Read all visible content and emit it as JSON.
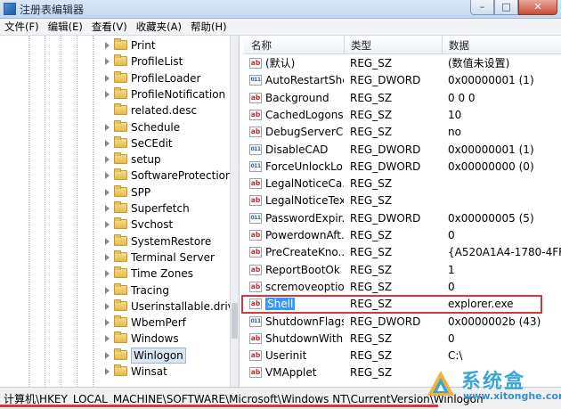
{
  "window": {
    "title": "注册表编辑器",
    "buttons": [
      "–",
      "□",
      "✕"
    ]
  },
  "menu": [
    {
      "label": "文件(F)"
    },
    {
      "label": "编辑(E)"
    },
    {
      "label": "查看(V)"
    },
    {
      "label": "收藏夹(A)"
    },
    {
      "label": "帮助(H)"
    }
  ],
  "tree": {
    "items": [
      {
        "label": "Print",
        "expandable": true
      },
      {
        "label": "ProfileList",
        "expandable": true
      },
      {
        "label": "ProfileLoader",
        "expandable": true
      },
      {
        "label": "ProfileNotification",
        "expandable": true
      },
      {
        "label": "related.desc",
        "expandable": false
      },
      {
        "label": "Schedule",
        "expandable": true
      },
      {
        "label": "SeCEdit",
        "expandable": true
      },
      {
        "label": "setup",
        "expandable": true
      },
      {
        "label": "SoftwareProtectionP",
        "expandable": true
      },
      {
        "label": "SPP",
        "expandable": true
      },
      {
        "label": "Superfetch",
        "expandable": true
      },
      {
        "label": "Svchost",
        "expandable": true
      },
      {
        "label": "SystemRestore",
        "expandable": true
      },
      {
        "label": "Terminal Server",
        "expandable": true
      },
      {
        "label": "Time Zones",
        "expandable": true
      },
      {
        "label": "Tracing",
        "expandable": true
      },
      {
        "label": "Userinstallable.drive",
        "expandable": true
      },
      {
        "label": "WbemPerf",
        "expandable": true
      },
      {
        "label": "Windows",
        "expandable": true
      },
      {
        "label": "Winlogon",
        "expandable": true,
        "selected": true
      },
      {
        "label": "Winsat",
        "expandable": true
      }
    ]
  },
  "list": {
    "headers": {
      "name": "名称",
      "type": "类型",
      "data": "数据"
    },
    "rows": [
      {
        "name": "(默认)",
        "type": "REG_SZ",
        "data": "(数值未设置)",
        "kind": "sz"
      },
      {
        "name": "AutoRestartShell",
        "type": "REG_DWORD",
        "data": "0x00000001 (1)",
        "kind": "dword"
      },
      {
        "name": "Background",
        "type": "REG_SZ",
        "data": "0 0 0",
        "kind": "sz"
      },
      {
        "name": "CachedLogons...",
        "type": "REG_SZ",
        "data": "10",
        "kind": "sz"
      },
      {
        "name": "DebugServerC...",
        "type": "REG_SZ",
        "data": "no",
        "kind": "sz"
      },
      {
        "name": "DisableCAD",
        "type": "REG_DWORD",
        "data": "0x00000001 (1)",
        "kind": "dword"
      },
      {
        "name": "ForceUnlockLo...",
        "type": "REG_DWORD",
        "data": "0x00000000 (0)",
        "kind": "dword"
      },
      {
        "name": "LegalNoticeCa...",
        "type": "REG_SZ",
        "data": "",
        "kind": "sz"
      },
      {
        "name": "LegalNoticeText",
        "type": "REG_SZ",
        "data": "",
        "kind": "sz"
      },
      {
        "name": "PasswordExpir...",
        "type": "REG_DWORD",
        "data": "0x00000005 (5)",
        "kind": "dword"
      },
      {
        "name": "PowerdownAft...",
        "type": "REG_SZ",
        "data": "0",
        "kind": "sz"
      },
      {
        "name": "PreCreateKno...",
        "type": "REG_SZ",
        "data": "{A520A1A4-1780-4FF",
        "kind": "sz"
      },
      {
        "name": "ReportBootOk",
        "type": "REG_SZ",
        "data": "1",
        "kind": "sz"
      },
      {
        "name": "scremoveoption",
        "type": "REG_SZ",
        "data": "0",
        "kind": "sz"
      },
      {
        "name": "Shell",
        "type": "REG_SZ",
        "data": "explorer.exe",
        "kind": "sz",
        "selected": true
      },
      {
        "name": "ShutdownFlags",
        "type": "REG_DWORD",
        "data": "0x0000002b (43)",
        "kind": "dword"
      },
      {
        "name": "ShutdownWith...",
        "type": "REG_SZ",
        "data": "0",
        "kind": "sz"
      },
      {
        "name": "Userinit",
        "type": "REG_SZ",
        "data": "C:\\",
        "kind": "sz"
      },
      {
        "name": "VMApplet",
        "type": "REG_SZ",
        "data": "",
        "kind": "sz"
      }
    ]
  },
  "statusbar": {
    "path": "计算机\\HKEY_LOCAL_MACHINE\\SOFTWARE\\Microsoft\\Windows NT\\CurrentVersion\\Winlogon"
  },
  "watermark": {
    "title": "系统盒",
    "url": "www.xitonghe.com"
  },
  "colors": {
    "highlight": "#d43a3a",
    "selection": "#3399ff"
  }
}
